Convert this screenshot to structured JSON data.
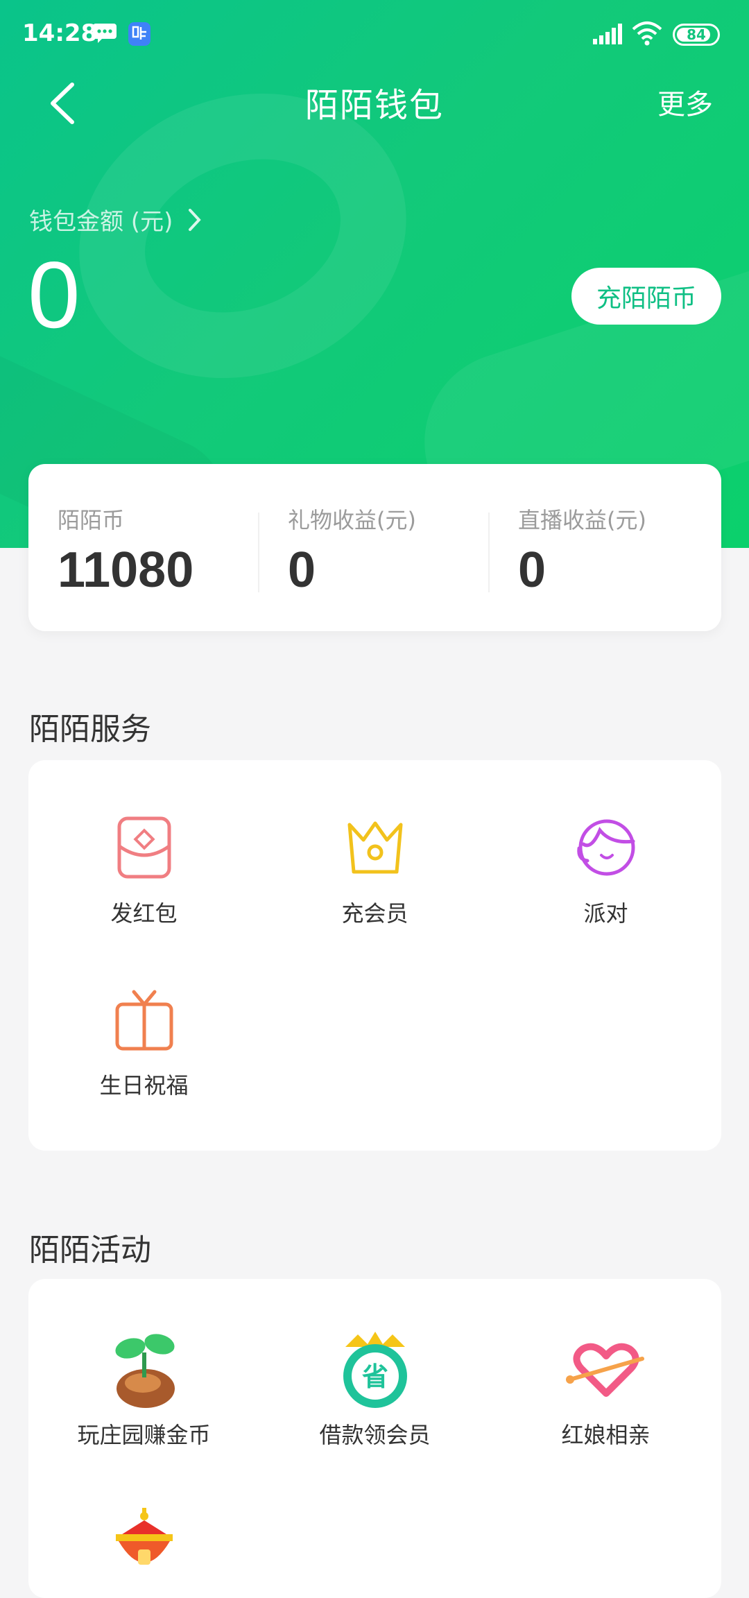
{
  "status_bar": {
    "time": "14:28",
    "battery": "84"
  },
  "nav": {
    "title": "陌陌钱包",
    "more": "更多"
  },
  "wallet": {
    "label": "钱包金额 (元)",
    "amount": "0",
    "recharge_button": "充陌陌币"
  },
  "balances": [
    {
      "label": "陌陌币",
      "value": "11080"
    },
    {
      "label": "礼物收益(元)",
      "value": "0"
    },
    {
      "label": "直播收益(元)",
      "value": "0"
    }
  ],
  "services": {
    "title": "陌陌服务",
    "items": [
      {
        "label": "发红包",
        "icon": "red-envelope-icon",
        "color": "#f07e82"
      },
      {
        "label": "充会员",
        "icon": "crown-icon",
        "color": "#f2c21c"
      },
      {
        "label": "派对",
        "icon": "party-face-icon",
        "color": "#c24ee5"
      },
      {
        "label": "生日祝福",
        "icon": "gift-icon",
        "color": "#f0804f"
      }
    ]
  },
  "activities": {
    "title": "陌陌活动",
    "items": [
      {
        "label": "玩庄园赚金币",
        "icon": "sprout-icon"
      },
      {
        "label": "借款领会员",
        "icon": "save-badge-icon"
      },
      {
        "label": "红娘相亲",
        "icon": "heart-arrow-icon"
      },
      {
        "label": "",
        "icon": "lantern-icon"
      }
    ]
  },
  "colors": {
    "accent": "#12c97a",
    "text": "#333333",
    "muted": "#9b9b9b"
  }
}
